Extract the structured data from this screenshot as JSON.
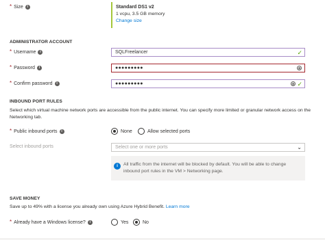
{
  "size": {
    "label": "Size",
    "name": "Standard DS1 v2",
    "detail": "1 vcpu, 3.5 GB memory",
    "change_link": "Change size"
  },
  "admin": {
    "heading": "ADMINISTRATOR ACCOUNT",
    "username_label": "Username",
    "username_value": "SQLFreelancer",
    "password_label": "Password",
    "password_value": "●●●●●●●●●",
    "confirm_label": "Confirm password",
    "confirm_value": "●●●●●●●●●"
  },
  "inbound": {
    "heading": "INBOUND PORT RULES",
    "description": "Select which virtual machine network ports are accessible from the public internet. You can specify more limited or granular network access on the Networking tab.",
    "public_label": "Public inbound ports",
    "option_none": "None",
    "option_allow": "Allow selected ports",
    "select_label": "Select inbound ports",
    "select_placeholder": "Select one or more ports",
    "info_text": "All traffic from the internet will be blocked by default. You will be able to change inbound port rules in the VM > Networking page."
  },
  "save": {
    "heading": "SAVE MONEY",
    "description": "Save up to 49% with a license you already own using Azure Hybrid Benefit.",
    "learn_more": "Learn more",
    "license_label": "Already have a Windows license?",
    "option_yes": "Yes",
    "option_no": "No"
  },
  "colors": {
    "accent": "#0078d4",
    "error": "#a4262c",
    "valid": "#57a300"
  }
}
